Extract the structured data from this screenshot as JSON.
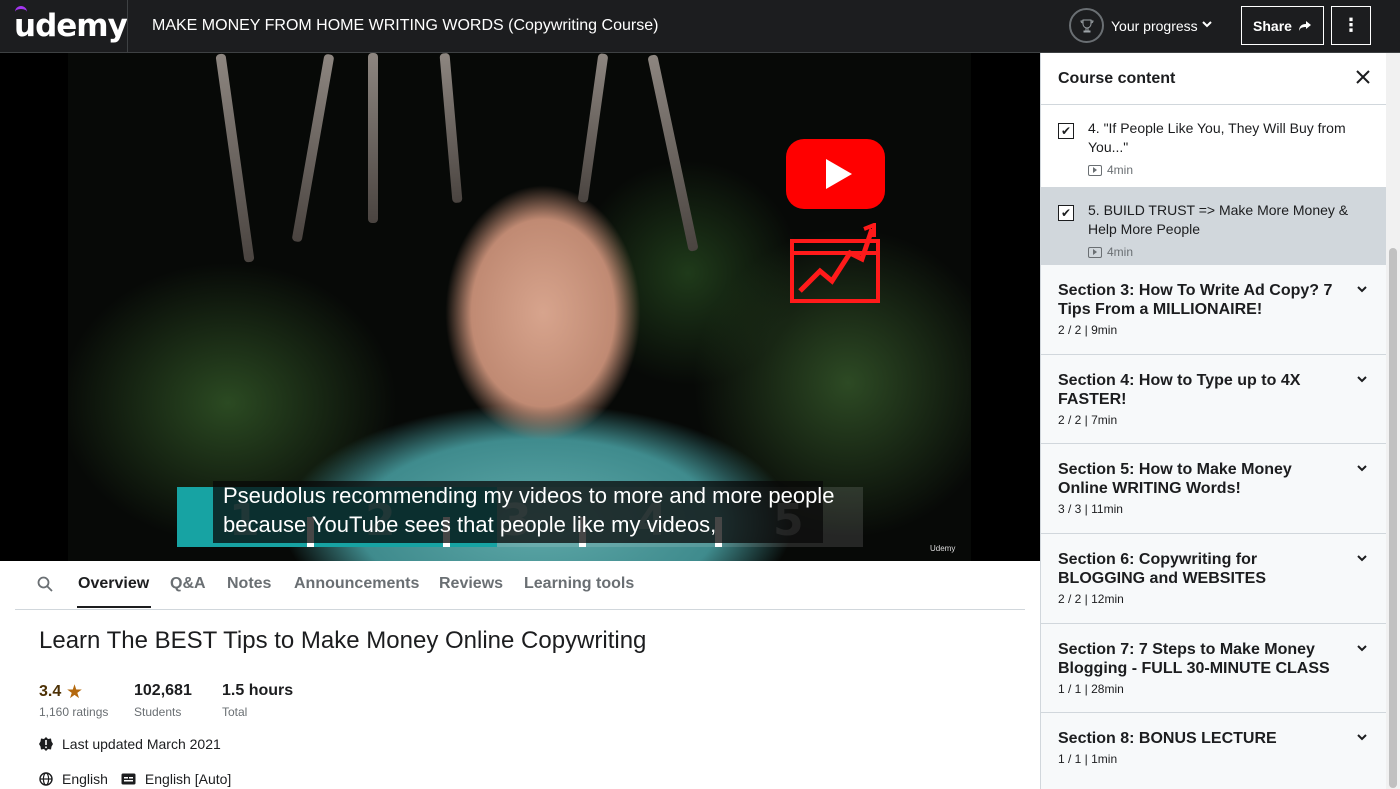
{
  "header": {
    "logo": "udemy",
    "course_title": "MAKE MONEY FROM HOME WRITING WORDS (Copywriting Course)",
    "progress_label": "Your progress",
    "share_label": "Share"
  },
  "video": {
    "subtitle_line1": "Pseudolus recommending my videos to more and more people",
    "subtitle_line2": "because YouTube sees that people like my videos,",
    "step_numbers": [
      "1",
      "2",
      "3",
      "4",
      "5"
    ],
    "watermark": "Udemy"
  },
  "sidebar": {
    "title": "Course content",
    "lectures": [
      {
        "title": "4. \"If People Like You, They Will Buy from You...\"",
        "duration": "4min",
        "checked": true,
        "active": false
      },
      {
        "title": "5. BUILD TRUST => Make More Money & Help More People",
        "duration": "4min",
        "checked": true,
        "active": true
      }
    ],
    "sections": [
      {
        "title": "Section 3: How To Write Ad Copy? 7 Tips From a MILLIONAIRE!",
        "meta": "2 / 2 | 9min"
      },
      {
        "title": "Section 4: How to Type up to 4X FASTER!",
        "meta": "2 / 2 | 7min"
      },
      {
        "title": "Section 5: How to Make Money Online WRITING Words!",
        "meta": "3 / 3 | 11min"
      },
      {
        "title": "Section 6: Copywriting for BLOGGING and WEBSITES",
        "meta": "2 / 2 | 12min"
      },
      {
        "title": "Section 7: 7 Steps to Make Money Blogging - FULL 30-MINUTE CLASS",
        "meta": "1 / 1 | 28min"
      },
      {
        "title": "Section 8: BONUS LECTURE",
        "meta": "1 / 1 | 1min"
      }
    ]
  },
  "tabs": [
    "Overview",
    "Q&A",
    "Notes",
    "Announcements",
    "Reviews",
    "Learning tools"
  ],
  "overview": {
    "title": "Learn The BEST Tips to Make Money Online Copywriting",
    "rating": "3.4",
    "ratings_count": "1,160 ratings",
    "students": "102,681",
    "students_label": "Students",
    "hours": "1.5 hours",
    "hours_label": "Total",
    "last_updated": "Last updated March 2021",
    "language": "English",
    "captions": "English [Auto]"
  },
  "colors": {
    "brand_purple": "#a435f0",
    "topbar": "#1c1d1f",
    "star": "#b4690e",
    "teal_bar": "#17a3a3",
    "youtube_red": "#ff0000"
  }
}
